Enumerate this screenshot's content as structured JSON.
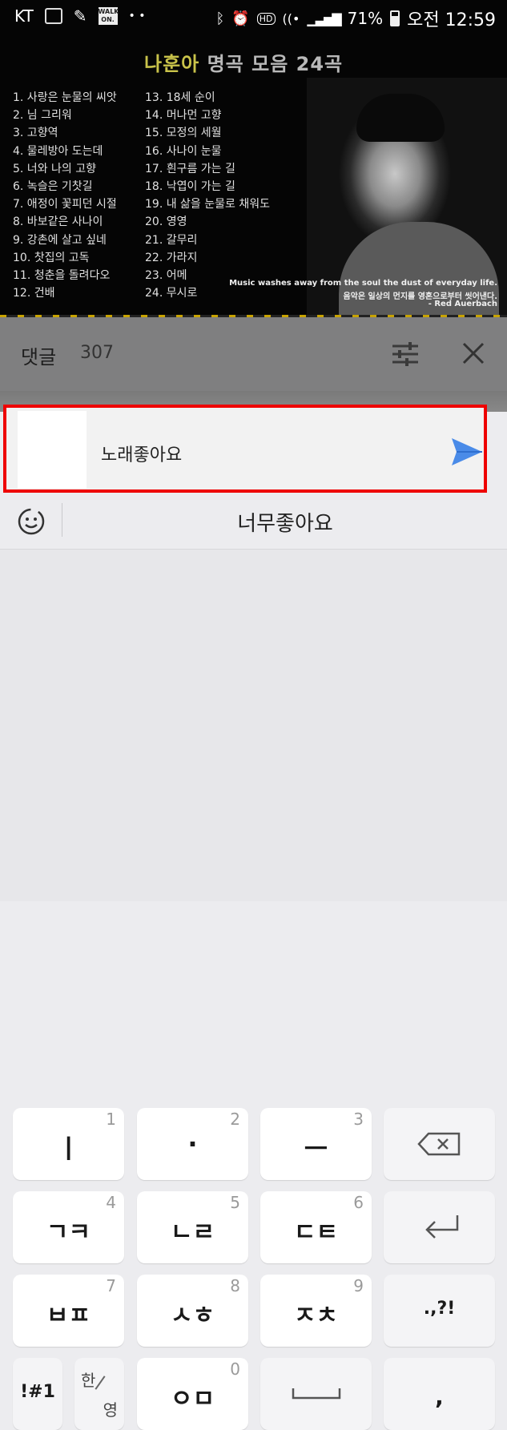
{
  "status_bar": {
    "carrier": "KT",
    "walk_badge": "WALK ON.",
    "battery": "71%",
    "time": "오전 12:59"
  },
  "video": {
    "title_highlight": "나훈아",
    "title_rest": " 명곡 모음 24곡",
    "tracks_left": [
      "1. 사랑은 눈물의 씨앗",
      "2. 님 그리워",
      "3. 고향역",
      "4. 물레방아 도는데",
      "5. 너와 나의 고향",
      "6. 녹슬은 기찻길",
      "7. 애정이 꽃피던 시절",
      "8. 바보같은 사나이",
      "9. 강촌에 살고 싶네",
      "10. 찻집의 고독",
      "11. 청춘을 돌려다오",
      "12. 건배"
    ],
    "tracks_right": [
      "13. 18세 순이",
      "14. 머나먼 고향",
      "15. 모정의 세월",
      "16. 사나이 눈물",
      "17. 흰구름 가는 길",
      "18. 낙엽이 가는 길",
      "19. 내 삶을 눈물로 채워도",
      "20. 영영",
      "21. 갈무리",
      "22. 가라지",
      "23. 어메",
      "24. 무시로"
    ],
    "quote_en": "Music washes away from the soul the dust of everyday life.",
    "quote_ko": "음악은 일상의 먼지를 영혼으로부터 씻어낸다.",
    "quote_author": "- Red Auerbach"
  },
  "comments": {
    "title": "댓글",
    "count": "307"
  },
  "compose": {
    "value": "노래좋아요"
  },
  "suggestion": {
    "text": "너무좋아요"
  },
  "keyboard": {
    "rows": [
      [
        {
          "label": "ㅣ",
          "num": "1"
        },
        {
          "label": "·",
          "num": "2"
        },
        {
          "label": "ㅡ",
          "num": "3"
        },
        {
          "label": "",
          "icon": "backspace-icon"
        }
      ],
      [
        {
          "label": "ㄱㅋ",
          "num": "4"
        },
        {
          "label": "ㄴㄹ",
          "num": "5"
        },
        {
          "label": "ㄷㅌ",
          "num": "6"
        },
        {
          "label": "",
          "icon": "enter-icon"
        }
      ],
      [
        {
          "label": "ㅂㅍ",
          "num": "7"
        },
        {
          "label": "ㅅㅎ",
          "num": "8"
        },
        {
          "label": "ㅈㅊ",
          "num": "9"
        },
        {
          "label": ".,?!"
        }
      ],
      [
        {
          "label": "!#1"
        },
        {
          "label_top": "한",
          "label_bottom": "영"
        },
        {
          "label": "ㅇㅁ",
          "num": "0"
        },
        {
          "label": "",
          "icon": "space-icon"
        },
        {
          "label": ","
        }
      ]
    ]
  },
  "colors": {
    "send_blue": "#4a8be8",
    "highlight_border": "#e00000",
    "title_yellow": "#c9c34a"
  }
}
